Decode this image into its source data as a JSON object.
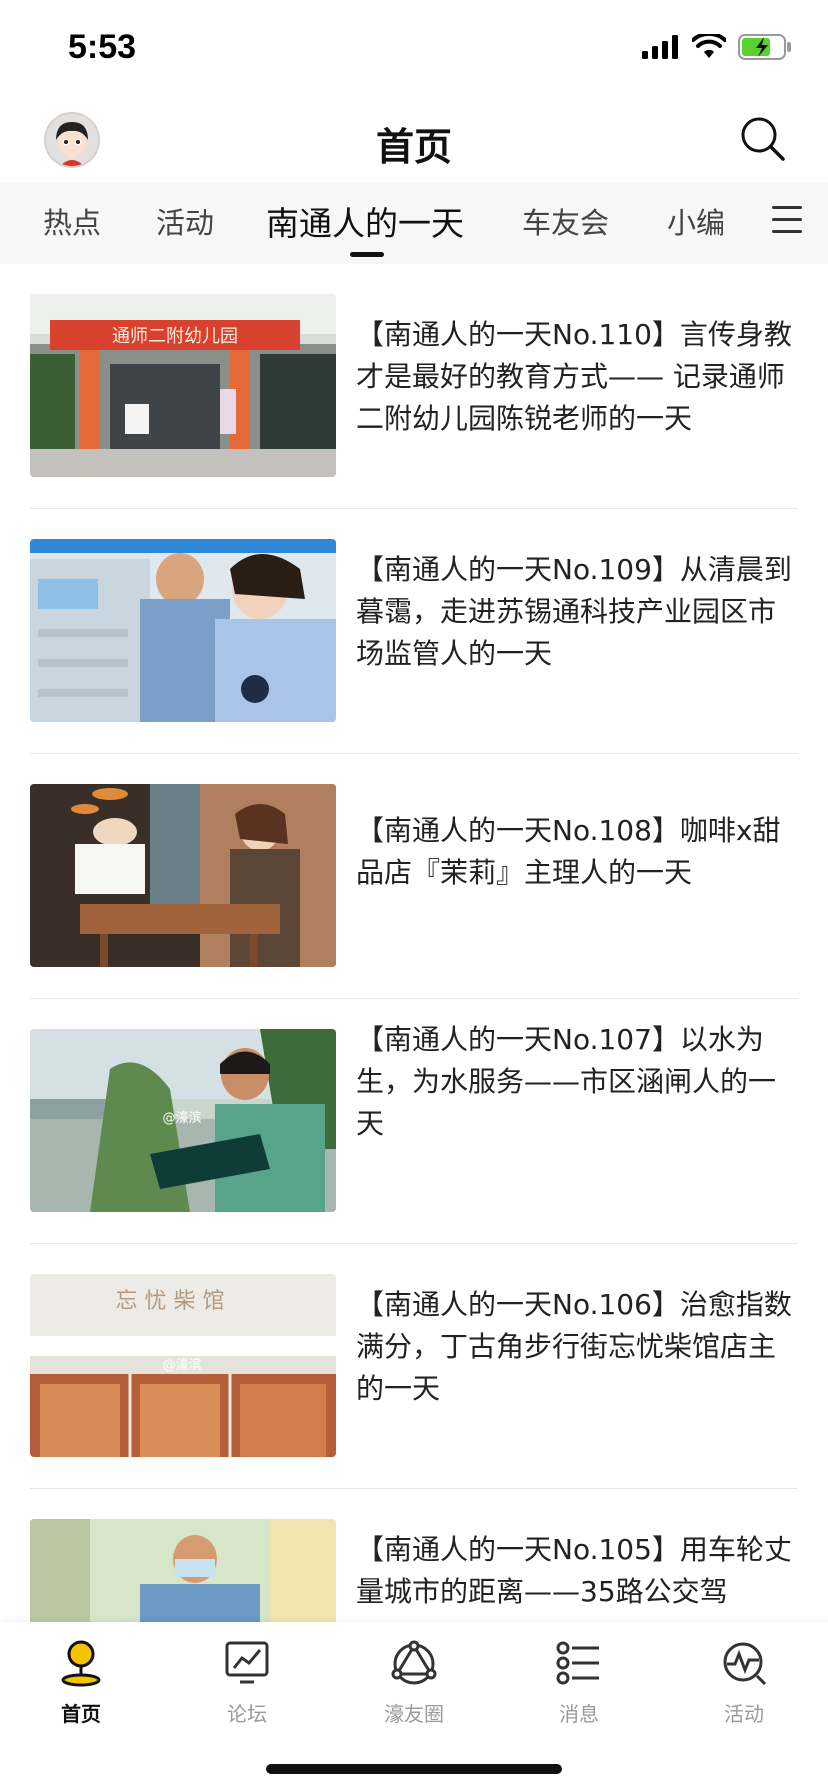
{
  "status_bar": {
    "time": "5:53"
  },
  "header": {
    "title": "首页"
  },
  "tabs": [
    {
      "label": "热点"
    },
    {
      "label": "活动"
    },
    {
      "label": "南通人的一天"
    },
    {
      "label": "车友会"
    },
    {
      "label": "小编"
    }
  ],
  "active_tab_index": 2,
  "articles": [
    {
      "title": "【南通人的一天No.110】言传身教才是最好的教育方式—— 记录通师二附幼儿园陈锐老师的一天",
      "thumb_caption": "通师二附幼儿园"
    },
    {
      "title": "【南通人的一天No.109】从清晨到暮霭，走进苏锡通科技产业园区市场监管人的一天"
    },
    {
      "title": "【南通人的一天No.108】咖啡x甜品店『茉莉』主理人的一天"
    },
    {
      "title": "【南通人的一天No.107】以水为生，为水服务——市区涵闸人的一天",
      "watermark": "@濠滨"
    },
    {
      "title": "【南通人的一天No.106】治愈指数满分，丁古角步行街忘忧柴馆店主的一天",
      "watermark": "@濠滨",
      "sign_text": "忘 忧 柴 馆"
    },
    {
      "title": "【南通人的一天No.105】用车轮丈量城市的距离——35路公交驾"
    }
  ],
  "bottom_nav": [
    {
      "label": "首页",
      "icon": "pin-icon"
    },
    {
      "label": "论坛",
      "icon": "chart-board-icon"
    },
    {
      "label": "濠友圈",
      "icon": "network-triangle-icon"
    },
    {
      "label": "消息",
      "icon": "list-icon"
    },
    {
      "label": "活动",
      "icon": "pulse-circle-icon"
    }
  ],
  "colors": {
    "accent": "#f5c400",
    "battery": "#5ad130"
  }
}
